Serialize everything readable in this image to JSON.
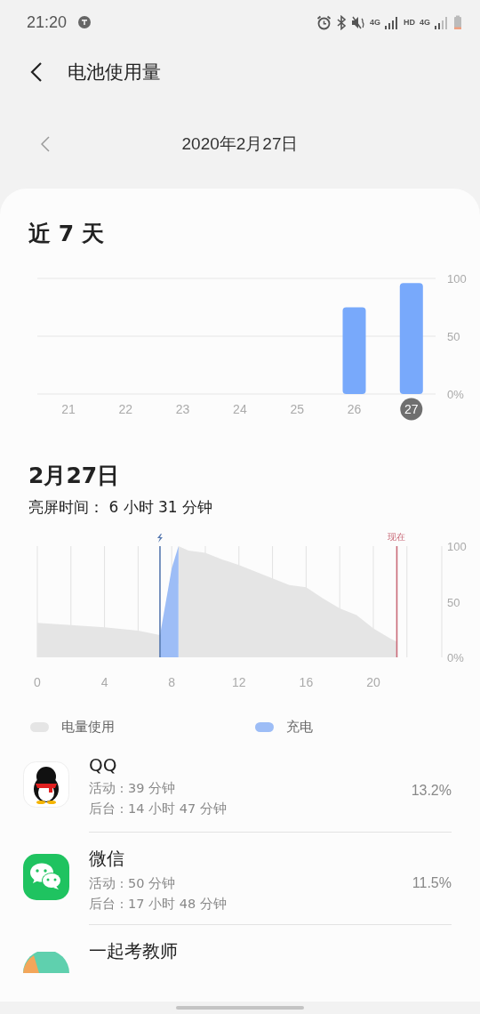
{
  "status_bar": {
    "time": "21:20",
    "network_1": "4G",
    "hd": "HD",
    "network_2": "4G"
  },
  "header": {
    "title": "电池使用量"
  },
  "date_nav": {
    "date": "2020年2月27日"
  },
  "week": {
    "title": "近 7 天",
    "days_selected": [
      false,
      false,
      false,
      false,
      false,
      false,
      true
    ],
    "chart_data": {
      "type": "bar",
      "categories": [
        "21",
        "22",
        "23",
        "24",
        "25",
        "26",
        "27"
      ],
      "series": [
        {
          "color": "#78a9fb",
          "values": [
            0,
            0,
            0,
            0,
            0,
            75,
            96
          ]
        }
      ],
      "grid": true,
      "ylim": [
        0,
        100
      ],
      "yticks": [
        {
          "value": 0,
          "label": "0%"
        },
        {
          "value": 50,
          "label": "50"
        },
        {
          "value": 100,
          "label": "100"
        }
      ]
    }
  },
  "day": {
    "title": "2月27日",
    "screen_time": "亮屏时间： 6 小时 31 分钟",
    "chart_data": {
      "type": "area",
      "x": [
        0,
        2,
        4,
        6,
        7.3,
        8,
        8.4,
        9,
        10,
        11,
        12,
        13,
        14,
        15,
        16,
        17,
        18,
        19,
        20,
        21,
        21.4
      ],
      "series": [
        {
          "name": "电量使用",
          "color": "#e5e5e5",
          "values": [
            31,
            29,
            27,
            24,
            20,
            null,
            100,
            96,
            94,
            88,
            83,
            77,
            71,
            65,
            63,
            53,
            44,
            38,
            26,
            17,
            14
          ]
        },
        {
          "name": "充电",
          "color": "#9dbdf6",
          "values": [
            null,
            null,
            null,
            null,
            20,
            80,
            100,
            null,
            null,
            null,
            null,
            null,
            null,
            null,
            null,
            null,
            null,
            null,
            null,
            null,
            null
          ]
        }
      ],
      "xlim": [
        0,
        22
      ],
      "ylim": [
        0,
        100
      ],
      "xticks": [
        0,
        4,
        8,
        12,
        16,
        20
      ],
      "grid": true,
      "yticks": [
        {
          "value": 0,
          "label": "0%"
        },
        {
          "value": 50,
          "label": "50"
        },
        {
          "value": 100,
          "label": "100"
        }
      ],
      "ref_lines": [
        {
          "axis": "x",
          "value": 7.3,
          "color": "#5779b0"
        },
        {
          "axis": "x",
          "value": 21.4,
          "color": "#c96a78",
          "label": "现在"
        }
      ]
    }
  },
  "apps": [
    {
      "kind": "penguin",
      "name": "QQ",
      "active": "活动 : 39 分钟",
      "background": "后台 : 14 小时 47 分钟",
      "percent": "13.2%"
    },
    {
      "kind": "chat",
      "name": "微信",
      "active": "活动 : 50 分钟",
      "background": "后台 : 17 小时 48 分钟",
      "percent": "11.5%"
    },
    {
      "kind": "round",
      "name": "一起考教师"
    }
  ]
}
